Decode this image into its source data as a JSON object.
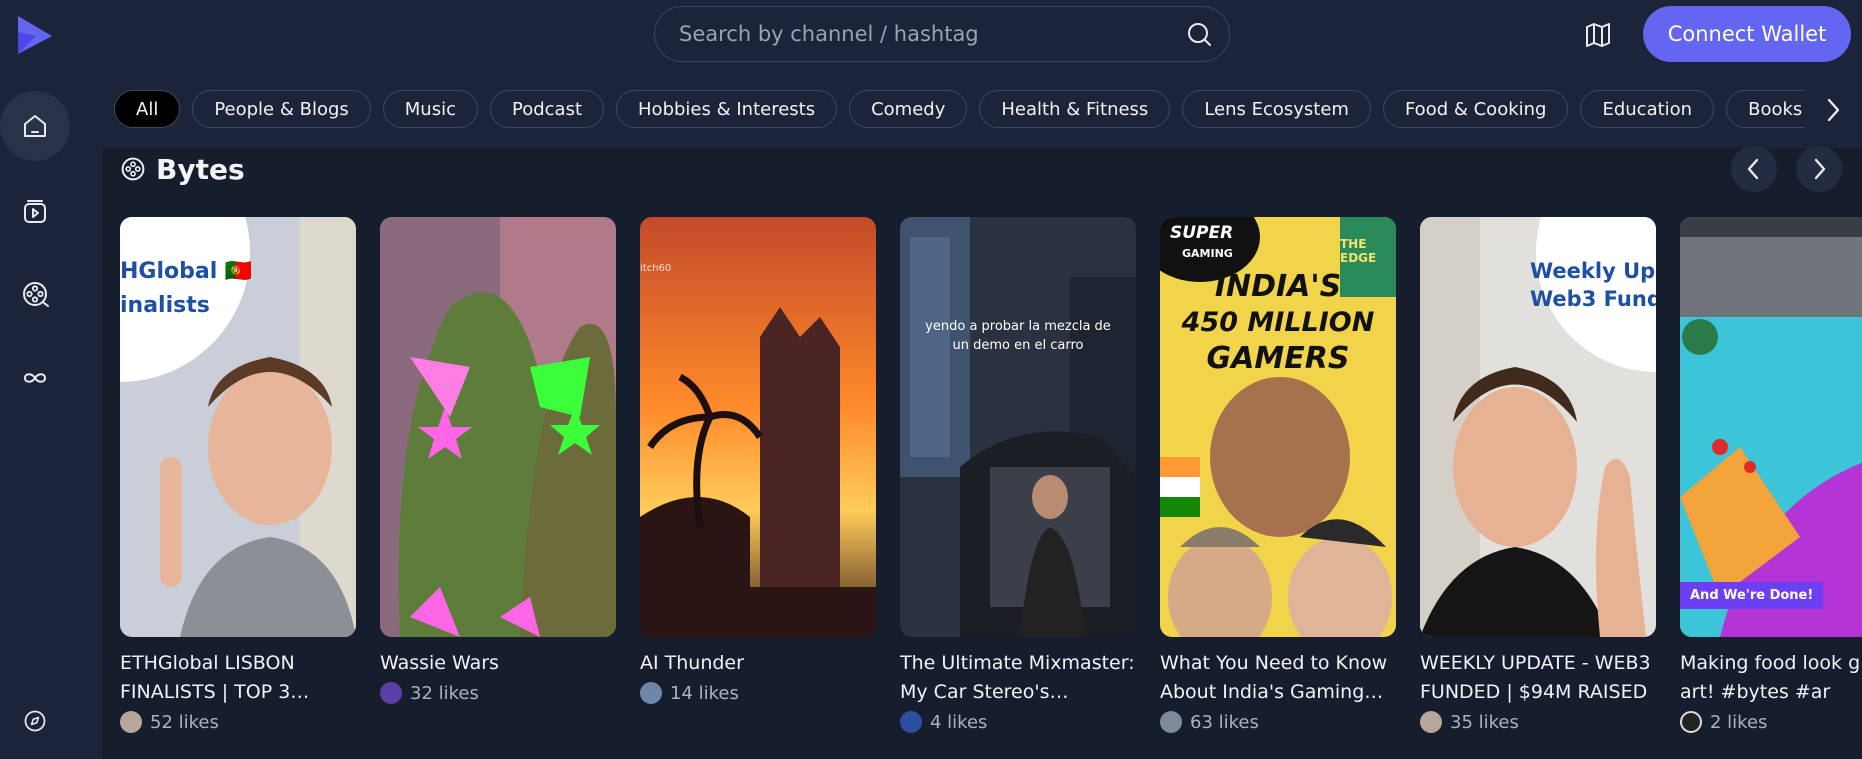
{
  "search": {
    "placeholder": "Search by channel / hashtag"
  },
  "header": {
    "connect_label": "Connect Wallet"
  },
  "categories": [
    "All",
    "People & Blogs",
    "Music",
    "Podcast",
    "Hobbies & Interests",
    "Comedy",
    "Health & Fitness",
    "Lens Ecosystem",
    "Food & Cooking",
    "Education",
    "Books & Liter"
  ],
  "section": {
    "title": "Bytes"
  },
  "cards": [
    {
      "title": "ETHGlobal LISBON FINALISTS | TOP 3…",
      "likes": "52 likes",
      "overlay": "HGlobal 🇵🇹\ninalists"
    },
    {
      "title": "Wassie Wars",
      "likes": "32 likes"
    },
    {
      "title": "AI Thunder",
      "likes": "14 likes",
      "overlay": "itch60"
    },
    {
      "title": "The Ultimate Mixmaster: My Car Stereo's Hidden…",
      "likes": "4 likes",
      "overlay": "yendo a probar la mezcla de un demo en el carro"
    },
    {
      "title": "What You Need to Know About India's Gaming…",
      "likes": "63 likes",
      "overlay": "INDIA'S 450 MILLION GAMERS"
    },
    {
      "title": "WEEKLY UPDATE - WEB3 FUNDED | $94M RAISED",
      "likes": "35 likes",
      "overlay": "Weekly Upd Web3 Fund"
    },
    {
      "title": "Making food look g an art! #bytes #ar",
      "likes": "2 likes",
      "overlay": "And We're Done!"
    }
  ],
  "overlays": {
    "card1_line1": "HGlobal 🇵🇹",
    "card1_line2": "inalists",
    "card3_tag": "itch60",
    "card4_line1": "yendo a probar la mezcla de",
    "card4_line2": "un demo en el carro",
    "card5_super": "SUPER",
    "card5_gaming": "GAMING",
    "card5_edge": "THE EDGE",
    "card5_l1": "INDIA'S",
    "card5_l2": "450 MILLION",
    "card5_l3": "GAMERS",
    "card6_line1": "Weekly Upd",
    "card6_line2": "Web3 Fund",
    "card7_badge": "And We're Done!"
  },
  "colors": {
    "accent": "#6366f1",
    "bg": "#1b2438",
    "panel": "#161e2e"
  }
}
